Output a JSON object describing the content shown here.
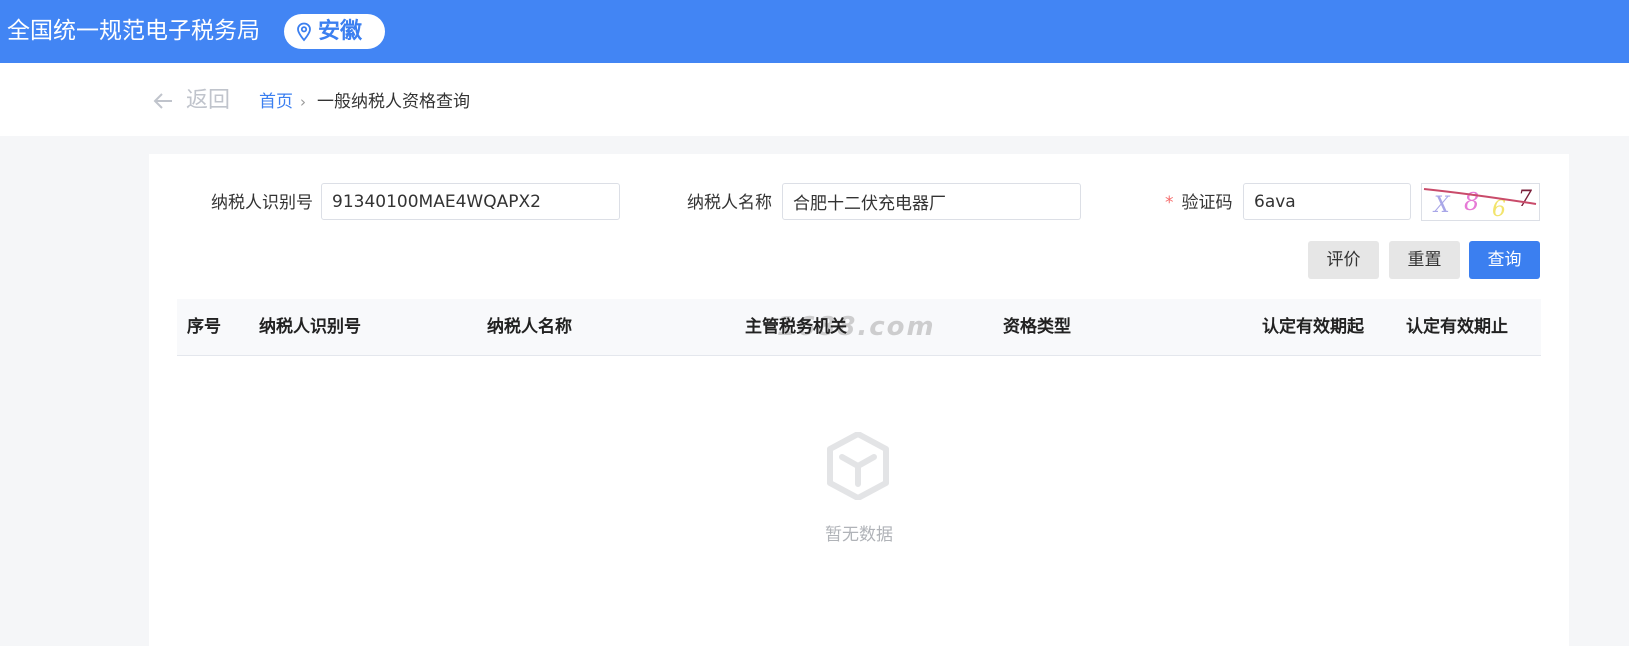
{
  "header": {
    "brand": "全国统一规范电子税务局",
    "region": "安徽",
    "region_icon": "map-pin-icon"
  },
  "breadcrumb": {
    "back_label": "返回",
    "home": "首页",
    "separator": "›",
    "current": "一般纳税人资格查询"
  },
  "form": {
    "taxpayer_id_label": "纳税人识别号",
    "taxpayer_id_value": "91340100MAE4WQAPX2",
    "taxpayer_name_label": "纳税人名称",
    "taxpayer_name_value": "合肥十二伏充电器厂",
    "captcha_required_mark": "*",
    "captcha_label": "验证码",
    "captcha_value": "6ava",
    "captcha_image_text": "X867"
  },
  "buttons": {
    "evaluate": "评价",
    "reset": "重置",
    "query": "查询"
  },
  "table": {
    "columns": [
      "序号",
      "纳税人识别号",
      "纳税人名称",
      "主管税务机关",
      "资格类型",
      "认定有效期起",
      "认定有效期止"
    ],
    "watermark": "1688.com",
    "empty_text": "暂无数据"
  },
  "colors": {
    "primary": "#4285f4",
    "button_primary": "#3b7ff0",
    "required": "#f56c6c"
  }
}
